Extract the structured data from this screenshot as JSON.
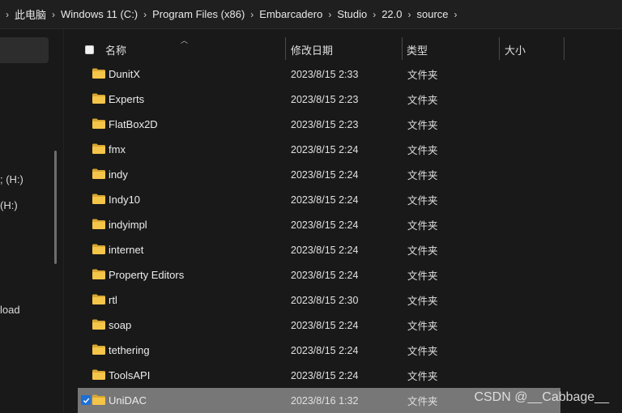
{
  "breadcrumb": [
    "此电脑",
    "Windows 11 (C:)",
    "Program Files (x86)",
    "Embarcadero",
    "Studio",
    "22.0",
    "source"
  ],
  "nav_items": [
    {
      "label": "; (H:)"
    },
    {
      "label": "(H:)"
    },
    {
      "label": "load"
    }
  ],
  "columns": {
    "name": "名称",
    "date": "修改日期",
    "type": "类型",
    "size": "大小"
  },
  "files": [
    {
      "name": "DunitX",
      "date": "2023/8/15 2:33",
      "type": "文件夹",
      "selected": false
    },
    {
      "name": "Experts",
      "date": "2023/8/15 2:23",
      "type": "文件夹",
      "selected": false
    },
    {
      "name": "FlatBox2D",
      "date": "2023/8/15 2:23",
      "type": "文件夹",
      "selected": false
    },
    {
      "name": "fmx",
      "date": "2023/8/15 2:24",
      "type": "文件夹",
      "selected": false
    },
    {
      "name": "indy",
      "date": "2023/8/15 2:24",
      "type": "文件夹",
      "selected": false
    },
    {
      "name": "Indy10",
      "date": "2023/8/15 2:24",
      "type": "文件夹",
      "selected": false
    },
    {
      "name": "indyimpl",
      "date": "2023/8/15 2:24",
      "type": "文件夹",
      "selected": false
    },
    {
      "name": "internet",
      "date": "2023/8/15 2:24",
      "type": "文件夹",
      "selected": false
    },
    {
      "name": "Property Editors",
      "date": "2023/8/15 2:24",
      "type": "文件夹",
      "selected": false
    },
    {
      "name": "rtl",
      "date": "2023/8/15 2:30",
      "type": "文件夹",
      "selected": false
    },
    {
      "name": "soap",
      "date": "2023/8/15 2:24",
      "type": "文件夹",
      "selected": false
    },
    {
      "name": "tethering",
      "date": "2023/8/15 2:24",
      "type": "文件夹",
      "selected": false
    },
    {
      "name": "ToolsAPI",
      "date": "2023/8/15 2:24",
      "type": "文件夹",
      "selected": false
    },
    {
      "name": "UniDAC",
      "date": "2023/8/16 1:32",
      "type": "文件夹",
      "selected": true
    }
  ],
  "watermark": "CSDN @__Cabbage__",
  "colors": {
    "folder": "#f5c54a",
    "folder_dark": "#d9a631",
    "selection": "#777777",
    "checkbox_checked": "#1d6fd6"
  }
}
